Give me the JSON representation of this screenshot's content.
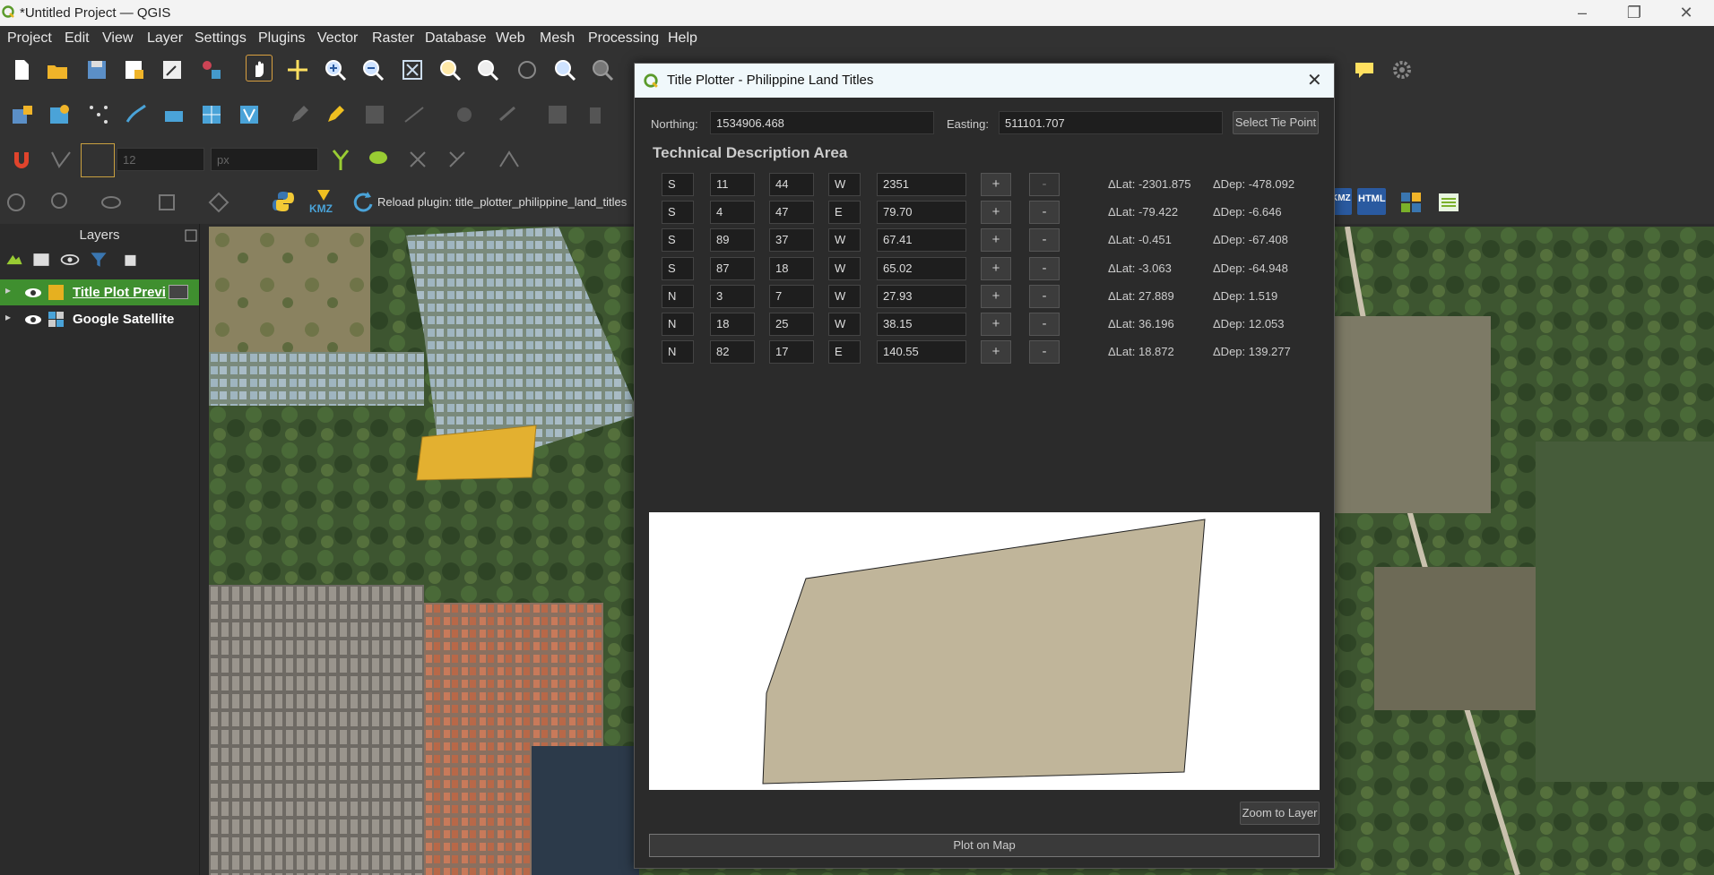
{
  "window": {
    "title": "*Untitled Project — QGIS"
  },
  "menu": [
    "Project",
    "Edit",
    "View",
    "Layer",
    "Settings",
    "Plugins",
    "Vector",
    "Raster",
    "Database",
    "Web",
    "Mesh",
    "Processing",
    "Help"
  ],
  "toolbar": {
    "snap_value": "12",
    "snap_unit": "px",
    "kmz_label": "KMZ",
    "reload_label": "Reload plugin: title_plotter_philippine_land_titles",
    "html_label": "HTML",
    "kmz2_label": "KMZ"
  },
  "layers": {
    "header": "Layers",
    "items": [
      {
        "name": "Title Plot Previ",
        "selected": true
      },
      {
        "name": "Google Satellite",
        "selected": false
      }
    ]
  },
  "dialog": {
    "title": "Title Plotter - Philippine Land Titles",
    "northing_label": "Northing:",
    "northing_value": "1534906.468",
    "easting_label": "Easting:",
    "easting_value": "511101.707",
    "tie_point_button": "Select Tie Point",
    "section_title": "Technical Description Area",
    "add_label": "+",
    "remove_label": "-",
    "rows": [
      {
        "ns": "S",
        "deg": "11",
        "min": "44",
        "ew": "W",
        "dist": "2351",
        "dlat": "ΔLat: -2301.875",
        "ddep": "ΔDep: -478.092"
      },
      {
        "ns": "S",
        "deg": "4",
        "min": "47",
        "ew": "E",
        "dist": "79.70",
        "dlat": "ΔLat: -79.422",
        "ddep": "ΔDep: -6.646"
      },
      {
        "ns": "S",
        "deg": "89",
        "min": "37",
        "ew": "W",
        "dist": "67.41",
        "dlat": "ΔLat: -0.451",
        "ddep": "ΔDep: -67.408"
      },
      {
        "ns": "S",
        "deg": "87",
        "min": "18",
        "ew": "W",
        "dist": "65.02",
        "dlat": "ΔLat: -3.063",
        "ddep": "ΔDep: -64.948"
      },
      {
        "ns": "N",
        "deg": "3",
        "min": "7",
        "ew": "W",
        "dist": "27.93",
        "dlat": "ΔLat: 27.889",
        "ddep": "ΔDep: 1.519"
      },
      {
        "ns": "N",
        "deg": "18",
        "min": "25",
        "ew": "W",
        "dist": "38.15",
        "dlat": "ΔLat: 36.196",
        "ddep": "ΔDep: 12.053"
      },
      {
        "ns": "N",
        "deg": "82",
        "min": "17",
        "ew": "E",
        "dist": "140.55",
        "dlat": "ΔLat: 18.872",
        "ddep": "ΔDep: 139.277"
      }
    ],
    "zoom_button": "Zoom to Layer",
    "plot_button": "Plot on Map"
  },
  "colors": {
    "accent_green": "#3f8f2f",
    "polygon_fill": "#c0b59a",
    "map_polygon": "#e3b030"
  }
}
